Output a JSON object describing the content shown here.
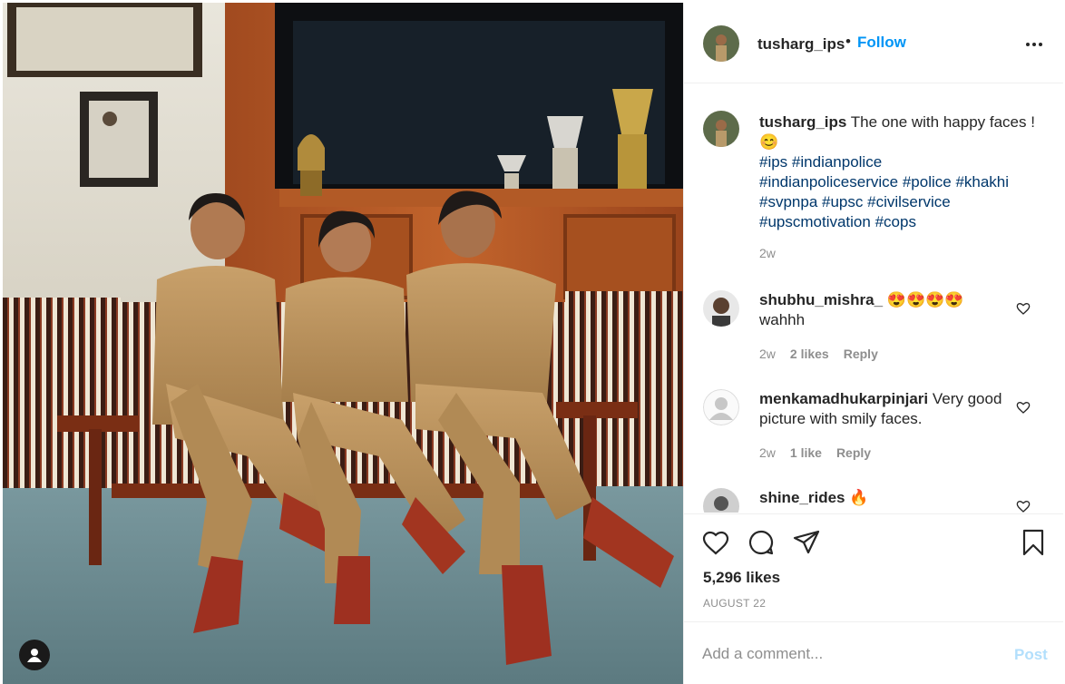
{
  "post": {
    "username": "tusharg_ips",
    "follow_label": "Follow",
    "header_separator": "•",
    "more_icon": "more-horizontal-icon"
  },
  "caption": {
    "username": "tusharg_ips",
    "text_main": " The one with happy faces ! ",
    "emoji": "😊",
    "hashtags": [
      "#ips",
      "#indianpolice",
      "#indianpoliceservice",
      "#police",
      "#khakhi",
      "#svpnpa",
      "#upsc",
      "#civilservice",
      "#upscmotivation",
      "#cops"
    ],
    "time": "2w"
  },
  "comments": [
    {
      "username": "shubhu_mishra_",
      "emoji": "😍😍😍😍",
      "text": "wahhh",
      "time": "2w",
      "likes": "2 likes",
      "reply": "Reply"
    },
    {
      "username": "menkamadhukarpinjari",
      "text": " Very good picture with smily faces.",
      "time": "2w",
      "likes": "1 like",
      "reply": "Reply"
    },
    {
      "username": "shine_rides",
      "emoji": "🔥"
    }
  ],
  "actions": {
    "likes": "5,296 likes",
    "date": "AUGUST 22",
    "icons": [
      "heart-icon",
      "comment-icon",
      "share-icon",
      "bookmark-icon"
    ]
  },
  "add_comment": {
    "placeholder": "Add a comment...",
    "post_label": "Post"
  },
  "colors": {
    "link_blue": "#0095f6",
    "hashtag": "#00376b",
    "muted": "#8e8e8e",
    "post_disabled": "#b2dffc"
  }
}
